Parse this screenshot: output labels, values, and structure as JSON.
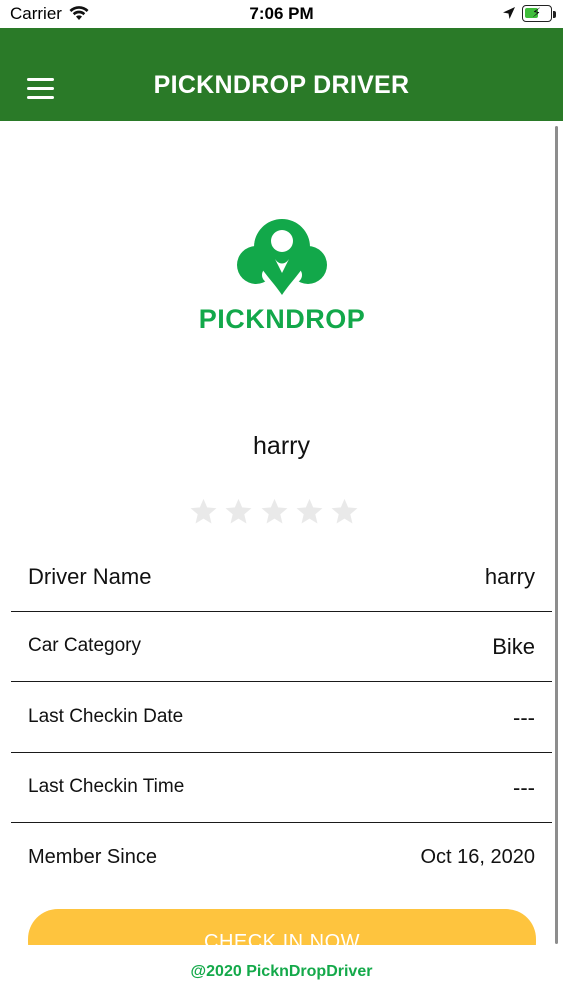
{
  "status_bar": {
    "carrier": "Carrier",
    "time": "7:06 PM",
    "icons": [
      "wifi-icon",
      "location-arrow-icon",
      "battery-charging-icon"
    ]
  },
  "header": {
    "title": "PICKNDROP DRIVER",
    "menu_icon": "hamburger-menu-icon",
    "background_color": "#2a7a28"
  },
  "logo": {
    "text": "PICKNDROP",
    "color": "#12a84a"
  },
  "profile": {
    "name": "harry",
    "rating": 0,
    "rating_max": 5
  },
  "details": [
    {
      "label": "Driver Name",
      "value": "harry"
    },
    {
      "label": "Car Category",
      "value": "Bike"
    },
    {
      "label": "Last Checkin Date",
      "value": "---"
    },
    {
      "label": "Last Checkin Time",
      "value": "---"
    },
    {
      "label": "Member Since",
      "value": "Oct 16, 2020"
    }
  ],
  "checkin_button": {
    "label": "CHECK IN NOW",
    "color": "#fec43e"
  },
  "footer": {
    "text": "@2020 PicknDropDriver"
  }
}
